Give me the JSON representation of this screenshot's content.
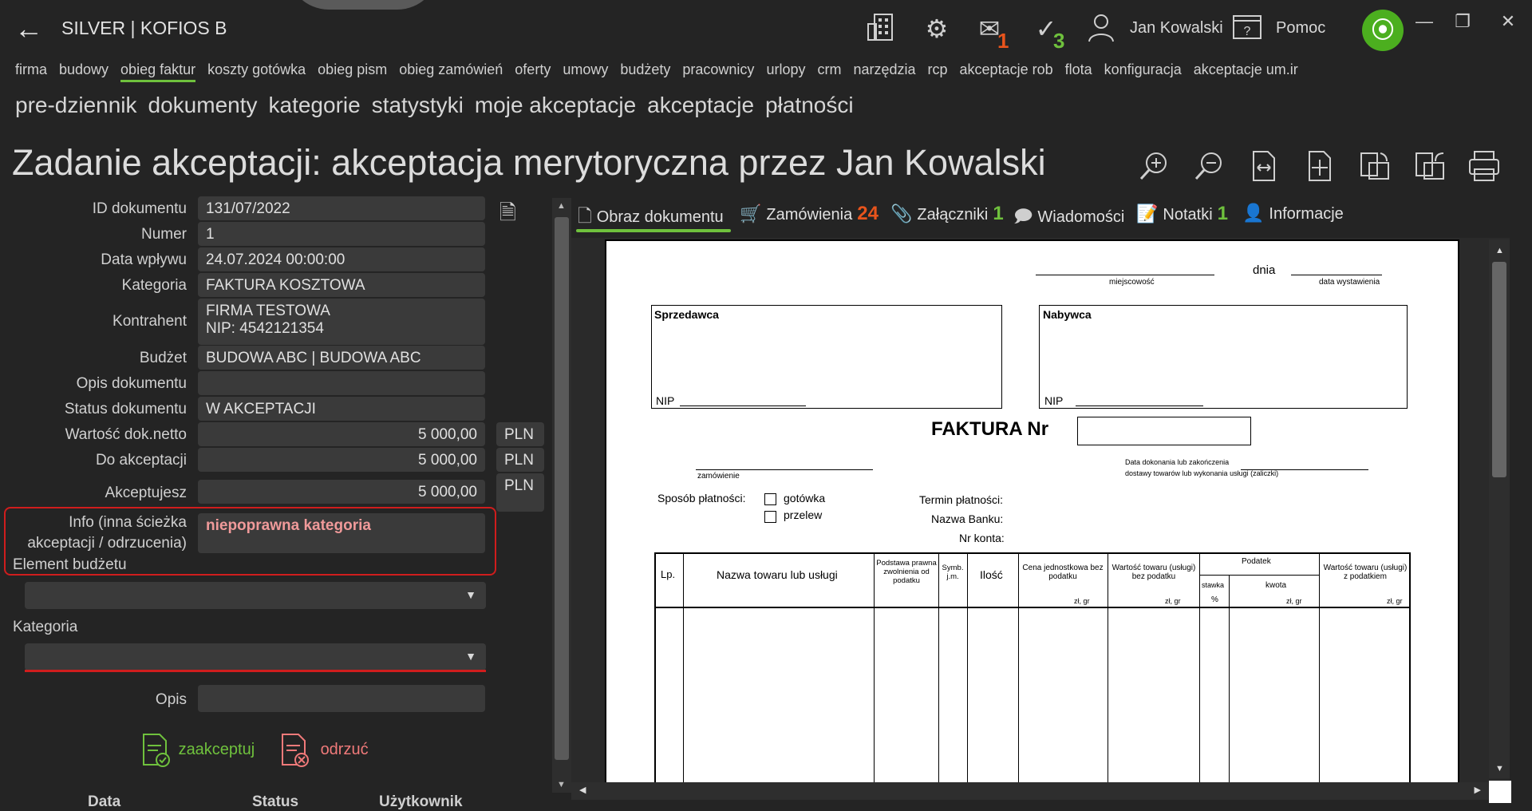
{
  "app": {
    "title": "SILVER | KOFIOS B",
    "user": "Jan Kowalski",
    "help": "Pomoc"
  },
  "notifications": {
    "mail_count": "1",
    "tasks_count": "3",
    "color_mail": "#e8541c",
    "color_tasks": "#6fc13d"
  },
  "icons": {
    "back": "arrow-left",
    "building": "building-icon",
    "settings": "gear-icon",
    "mail": "mail-icon",
    "tasks": "check-list-icon",
    "user": "user-icon",
    "help": "help-icon",
    "logo": "app-logo",
    "zoom_in": "zoom-in-icon",
    "zoom_out": "zoom-out-icon"
  },
  "menu_main": [
    "firma",
    "budowy",
    "obieg faktur",
    "koszty gotówka",
    "obieg pism",
    "obieg zamówień",
    "oferty",
    "umowy",
    "budżety",
    "pracownicy",
    "urlopy",
    "crm",
    "narzędzia",
    "rcp",
    "akceptacje rob",
    "flota",
    "konfiguracja",
    "akceptacje um.ir"
  ],
  "menu_sub": [
    "pre-dziennik",
    "dokumenty",
    "kategorie",
    "statystyki",
    "moje akceptacje",
    "akceptacje",
    "płatności"
  ],
  "page_title": "Zadanie akceptacji: akceptacja merytoryczna przez Jan Kowalski",
  "form": {
    "id_label": "ID dokumentu",
    "id_value": "131/07/2022",
    "numer_label": "Numer",
    "numer_value": "1",
    "data_label": "Data wpływu",
    "data_value": "24.07.2024 00:00:00",
    "kategoria_label": "Kategoria",
    "kategoria_value": "FAKTURA KOSZTOWA",
    "kontrahent_label": "Kontrahent",
    "kontrahent_line1": "FIRMA TESTOWA",
    "kontrahent_line2": "NIP: 4542121354",
    "budzet_label": "Budżet",
    "budzet_value": "BUDOWA ABC | BUDOWA ABC",
    "opis_dok_label": "Opis dokumentu",
    "opis_dok_value": "",
    "status_label": "Status dokumentu",
    "status_value": "W AKCEPTACJI",
    "netto_label": "Wartość dok.netto",
    "netto_value": "5 000,00",
    "netto_cur": "PLN",
    "doakc_label": "Do akceptacji",
    "doakc_value": "5 000,00",
    "doakc_cur": "PLN",
    "akceptujesz_label": "Akceptujesz",
    "akceptujesz_value": "5 000,00",
    "akceptujesz_cur": "PLN",
    "info_label_1": "Info (inna ścieżka",
    "info_label_2": "akceptacji / odrzucenia)",
    "info_value": "niepoprawna kategoria",
    "element_label": "Element budżetu",
    "element_value": "",
    "kat2_label": "Kategoria",
    "kat2_value": "",
    "opis_label": "Opis",
    "opis_value": "",
    "accept": "zaakceptuj",
    "reject": "odrzuć",
    "col_data": "Data",
    "col_status": "Status",
    "col_user": "Użytkownik"
  },
  "tabs": [
    {
      "label": "Obraz dokumentu",
      "count": ""
    },
    {
      "label": "Zamówienia",
      "count": "24"
    },
    {
      "label": "Załączniki",
      "count": "1"
    },
    {
      "label": "Wiadomości",
      "count": ""
    },
    {
      "label": "Notatki",
      "count": "1"
    },
    {
      "label": "Informacje",
      "count": ""
    }
  ],
  "invoice": {
    "dnia": "dnia",
    "miejscowosc": "miejscowość",
    "data_wyst": "data wystawienia",
    "sprzedawca": "Sprzedawca",
    "nabywca": "Nabywca",
    "nip": "NIP",
    "nip2": "NIP",
    "title": "FAKTURA  Nr",
    "zamowienie": "zamówienie",
    "data_dok_1": "Data dokonania lub zakończenia",
    "data_dok_2": "dostawy towarów lub wykonania usługi (zaliczki)",
    "sposob": "Sposób płatności:",
    "gotowka": "gotówka",
    "przelew": "przelew",
    "termin": "Termin płatności:",
    "bank": "Nazwa Banku:",
    "konto": "Nr konta:",
    "h_lp": "Lp.",
    "h_nazwa": "Nazwa towaru lub usługi",
    "h_podstawa": "Podstawa prawna zwolnienia od podatku",
    "h_symb": "Symb. j.m.",
    "h_ilosc": "Ilość",
    "h_cena": "Cena jednostkowa bez podatku",
    "h_wart": "Wartość towaru (usługi) bez podatku",
    "h_podatek": "Podatek",
    "h_stawka": "stawka",
    "h_proc": "%",
    "h_kwota": "kwota",
    "h_brutto": "Wartość towaru (usługi) z podatkiem",
    "zl_gr": "zł,  gr"
  }
}
